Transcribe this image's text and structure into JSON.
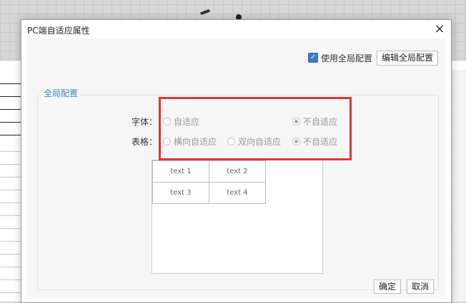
{
  "dialog": {
    "title": "PC端自适应属性",
    "close_symbol": "×"
  },
  "global_config": {
    "use_global_label": "使用全局配置",
    "use_global_checked": true,
    "edit_button_label": "编辑全局配置"
  },
  "group": {
    "title": "全局配置",
    "font": {
      "label": "字体：",
      "options": [
        {
          "label": "自适应",
          "selected": false
        },
        {
          "label": "不自适应",
          "selected": true
        }
      ]
    },
    "table": {
      "label": "表格：",
      "options": [
        {
          "label": "横向自适应",
          "selected": false
        },
        {
          "label": "双向自适应",
          "selected": false
        },
        {
          "label": "不自适应",
          "selected": true
        }
      ]
    }
  },
  "preview": {
    "cells": [
      [
        "text 1",
        "text 2"
      ],
      [
        "text 3",
        "text 4"
      ]
    ]
  },
  "footer": {
    "ok_label": "确定",
    "cancel_label": "取消"
  },
  "colors": {
    "accent": "#3a87c8",
    "highlight": "#e03434",
    "checkbox": "#3c78c8"
  }
}
